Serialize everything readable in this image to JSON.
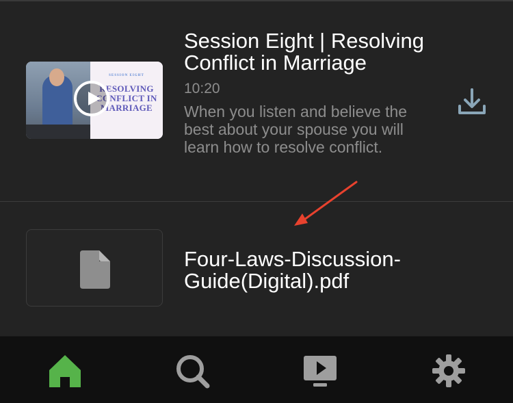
{
  "items": [
    {
      "type": "video",
      "title": "Session Eight | Resolving Conflict in Marriage",
      "duration": "10:20",
      "description": "When you listen and believe the best about your spouse you will learn how to resolve conflict.",
      "thumbnail": {
        "label_small": "SESSION EIGHT",
        "label_line1": "RESOLVING",
        "label_line2": "CONFLICT IN",
        "label_line3": "MARRIAGE"
      },
      "icons": [
        "play-icon",
        "download-icon"
      ]
    },
    {
      "type": "file",
      "title": "Four-Laws-Discussion-Guide(Digital).pdf",
      "icons": [
        "document-icon"
      ]
    }
  ],
  "annotation": {
    "type": "arrow",
    "color": "#e8422e"
  },
  "tabbar": {
    "tabs": [
      {
        "name": "home",
        "icon": "home-icon",
        "active": true
      },
      {
        "name": "search",
        "icon": "search-icon",
        "active": false
      },
      {
        "name": "videos",
        "icon": "video-play-icon",
        "active": false
      },
      {
        "name": "settings",
        "icon": "gear-icon",
        "active": false
      }
    ]
  },
  "colors": {
    "background": "#232323",
    "tabbar_background": "#101010",
    "active_tab": "#56b34a",
    "inactive_tab": "#9e9e9e",
    "title_text": "#ffffff",
    "secondary_text": "#8d8d8d",
    "download_icon": "#8aa6b8"
  }
}
